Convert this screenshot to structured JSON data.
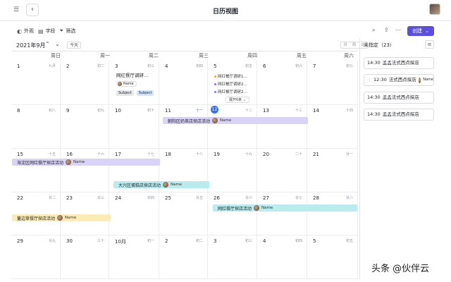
{
  "header": {
    "title": "日历视图",
    "menu_icon": "list-icon",
    "back_icon": "chevron-left-icon"
  },
  "toolbar": {
    "appearance": "外观",
    "fields": "字段",
    "filter": "筛选",
    "create": "创建"
  },
  "calendar": {
    "month": "2021年9月",
    "today": "今天",
    "views": [
      "月",
      "周",
      "日"
    ],
    "weekdays": [
      "周日",
      "周一",
      "周二",
      "周三",
      "周四",
      "周五",
      "周六"
    ],
    "weeks": [
      [
        [
          "1",
          "九月"
        ],
        [
          "2",
          "初二"
        ],
        [
          "3",
          "初三"
        ],
        [
          "4",
          "初四"
        ],
        [
          "5",
          "初五"
        ],
        [
          "6",
          "初六"
        ],
        [
          "7",
          "初七"
        ]
      ],
      [
        [
          "8",
          "初八"
        ],
        [
          "9",
          "初九"
        ],
        [
          "10",
          "初十"
        ],
        [
          "11",
          "十一"
        ],
        [
          "12",
          "十二"
        ],
        [
          "13",
          "十三"
        ],
        [
          "14",
          "十四"
        ]
      ],
      [
        [
          "15",
          "十五"
        ],
        [
          "16",
          "十六"
        ],
        [
          "17",
          "十七"
        ],
        [
          "18",
          "十八"
        ],
        [
          "19",
          "十九"
        ],
        [
          "20",
          "二十"
        ],
        [
          "21",
          "廿一"
        ]
      ],
      [
        [
          "22",
          "廿二"
        ],
        [
          "23",
          "廿三"
        ],
        [
          "24",
          "廿四"
        ],
        [
          "25",
          "廿五"
        ],
        [
          "26",
          "廿六"
        ],
        [
          "27",
          "廿七"
        ],
        [
          "28",
          "廿八"
        ]
      ],
      [
        [
          "29",
          "廿九"
        ],
        [
          "30",
          "三十"
        ],
        [
          "10月",
          "初一"
        ],
        [
          "2",
          "初二"
        ],
        [
          "3",
          "初三"
        ],
        [
          "4",
          "初四"
        ],
        [
          "5",
          "初五"
        ]
      ]
    ],
    "today_date": "12",
    "events": {
      "card_title": "网红餐厅调研…",
      "card_name": "Name",
      "card_chip1": "Subject",
      "card_chip2": "Subject",
      "mini1": "网红餐厅调研1…",
      "mini2": "网红餐厅调研2…",
      "mini3": "网红餐厅调研2…",
      "expand": "展开6条",
      "bar1": "朝阳区奶茶店探店活动",
      "bar2": "海淀区网红餐厅探店活动",
      "bar3": "大兴区蛋糕店探店活动",
      "bar4": "网红餐厅探店活动",
      "bar5": "簋边草餐厅探店活动",
      "name": "Name"
    },
    "colors": {
      "purple": "#d9d3f7",
      "cyan": "#b8ecef",
      "yellow": "#fbecb6",
      "today": "#3370ff",
      "create": "#5b4fe0"
    }
  },
  "sidebar": {
    "title": "未指定（23）",
    "items": [
      {
        "time": "14:30",
        "text": "孟孟法式西点探店"
      },
      {
        "time": "12:30",
        "text": "法式西点探店",
        "name": "Name"
      },
      {
        "time": "14:30",
        "text": "孟孟法式西点探店"
      },
      {
        "time": "14:30",
        "text": "孟孟法式西点探店"
      }
    ]
  },
  "watermark": "头条 @伙伴云"
}
